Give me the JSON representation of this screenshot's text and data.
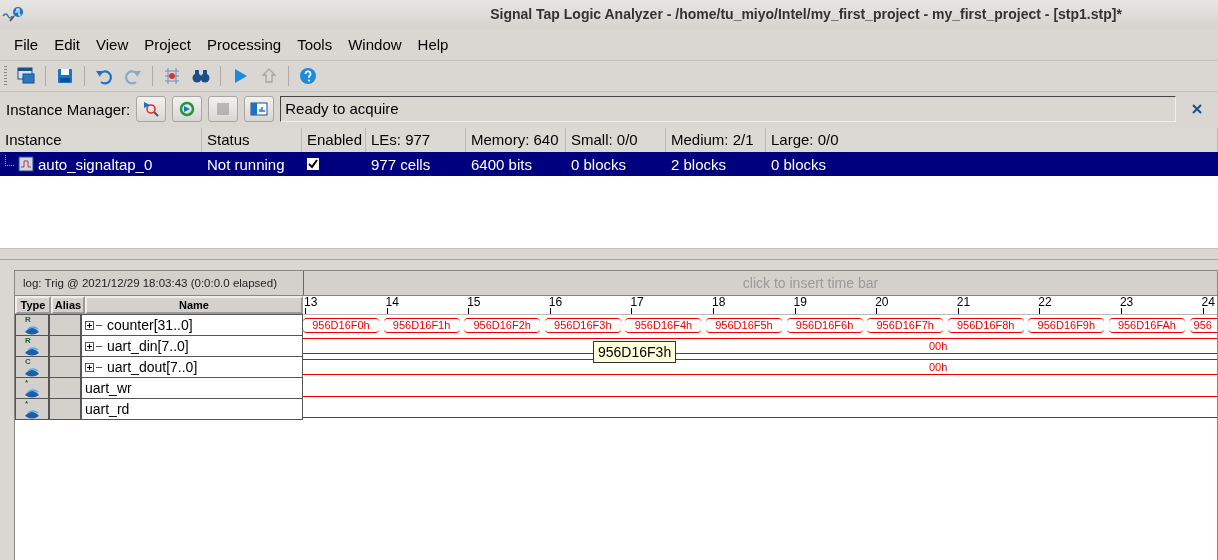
{
  "window": {
    "title": "Signal Tap Logic Analyzer - /home/tu_miyo/Intel/my_first_project - my_first_project - [stp1.stp]*"
  },
  "menu": [
    {
      "label": "File"
    },
    {
      "label": "Edit"
    },
    {
      "label": "View"
    },
    {
      "label": "Project"
    },
    {
      "label": "Processing"
    },
    {
      "label": "Tools"
    },
    {
      "label": "Window"
    },
    {
      "label": "Help"
    }
  ],
  "toolbar": [
    {
      "kind": "window"
    },
    {
      "kind": "sep"
    },
    {
      "kind": "save"
    },
    {
      "kind": "sep"
    },
    {
      "kind": "undo",
      "disabled": false
    },
    {
      "kind": "redo",
      "disabled": true
    },
    {
      "kind": "sep"
    },
    {
      "kind": "node"
    },
    {
      "kind": "find"
    },
    {
      "kind": "sep"
    },
    {
      "kind": "run",
      "disabled": false
    },
    {
      "kind": "autorun",
      "disabled": true
    },
    {
      "kind": "sep"
    },
    {
      "kind": "help"
    }
  ],
  "instance_manager": {
    "label": "Instance Manager:",
    "buttons": [
      {
        "kind": "scan",
        "disabled": false
      },
      {
        "kind": "autorun",
        "disabled": false
      },
      {
        "kind": "stop",
        "disabled": true
      },
      {
        "kind": "read",
        "disabled": false
      }
    ],
    "status": "Ready to acquire"
  },
  "instance_table": {
    "columns": [
      "Instance",
      "Status",
      "Enabled",
      "LEs: 977",
      "Memory: 640",
      "Small: 0/0",
      "Medium: 2/1",
      "Large: 0/0"
    ],
    "rows": [
      {
        "instance": "auto_signaltap_0",
        "status": "Not running",
        "enabled": true,
        "les": "977 cells",
        "memory": "6400 bits",
        "small": "0 blocks",
        "medium": "2 blocks",
        "large": "0 blocks",
        "selected": true
      }
    ]
  },
  "waveform": {
    "log": "log: Trig @ 2021/12/29 18:03:43 (0:0:0.0 elapsed)",
    "timebar_hint": "click to insert time bar",
    "columns": [
      "Type",
      "Alias",
      "Name"
    ],
    "ticks": [
      "13",
      "14",
      "15",
      "16",
      "17",
      "18",
      "19",
      "20",
      "21",
      "22",
      "23",
      "24"
    ],
    "signals": [
      {
        "name": "counter[31..0]",
        "type_glyph": "R",
        "kind": "bus",
        "expandable": true,
        "values": [
          "956D16F0h",
          "956D16F1h",
          "956D16F2h",
          "956D16F3h",
          "956D16F4h",
          "956D16F5h",
          "956D16F6h",
          "956D16F7h",
          "956D16F8h",
          "956D16F9h",
          "956D16FAh",
          "956"
        ]
      },
      {
        "name": "uart_din[7..0]",
        "type_glyph": "R",
        "kind": "bus",
        "expandable": true,
        "values": [
          "00h"
        ]
      },
      {
        "name": "uart_dout[7..0]",
        "type_glyph": "C",
        "kind": "bus",
        "expandable": true,
        "values": [
          "00h"
        ]
      },
      {
        "name": "uart_wr",
        "type_glyph": "*",
        "kind": "bit",
        "expandable": false
      },
      {
        "name": "uart_rd",
        "type_glyph": "*",
        "kind": "bit",
        "expandable": false
      }
    ],
    "tooltip": "956D16F3h"
  }
}
